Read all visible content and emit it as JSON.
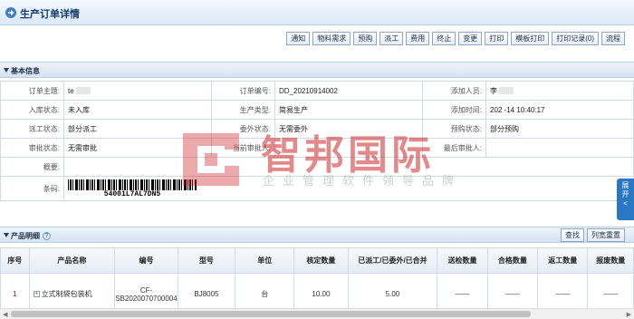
{
  "page": {
    "title": "生产订单详情"
  },
  "toolbar": [
    "通知",
    "物料需求",
    "预购",
    "派工",
    "费用",
    "终止",
    "变更",
    "打印",
    "模板打印",
    "打印记录(0)",
    "流程"
  ],
  "basic_info": {
    "heading": "基本信息",
    "subject_label": "订单主题:",
    "subject_value": "te",
    "order_no_label": "订单编号:",
    "order_no_value": "DD_20210914002",
    "added_by_label": "添加人员:",
    "added_by_value": "李",
    "inbound_label": "入库状态:",
    "inbound_value": "未入库",
    "prod_type_label": "生产类型:",
    "prod_type_value": "简易生产",
    "added_time_label": "添加时间:",
    "added_time_value": "202 -14 10:40:17",
    "dispatch_label": "派工状态:",
    "dispatch_value": "部分派工",
    "outsource_label": "委外状态:",
    "outsource_value": "无需委外",
    "prepurchase_label": "预购状态:",
    "prepurchase_value": "部分预购",
    "approval_label": "审批状态:",
    "approval_value": "无需审批",
    "current_approver_label": "当前审批人:",
    "current_approver_value": "",
    "last_approver_label": "最后审批人:",
    "last_approver_value": "",
    "summary_label": "概要:",
    "summary_value": "",
    "barcode_label": "条码:",
    "barcode_value": "54001L7AL7DN5"
  },
  "products": {
    "heading": "产品明细",
    "buttons": {
      "search": "查找",
      "reset_columns": "列宽重置"
    },
    "columns": [
      "序号",
      "产品名称",
      "编号",
      "型号",
      "单位",
      "核定数量",
      "已派工/已委外/已合并",
      "送检数量",
      "合格数量",
      "返工数量",
      "报废数量"
    ],
    "rows": [
      {
        "index": "1",
        "name": "立式制袋包装机",
        "code_line1": "CF-",
        "code_line2": "SB2020070700004",
        "model": "BJ8005",
        "unit": "台",
        "approved_qty": "10.00",
        "dispatched": "5.00",
        "inspect_qty": "——",
        "qualified_qty": "——",
        "rework_qty": "——",
        "scrap_qty": "——"
      }
    ]
  },
  "sidetab": {
    "line1": "展",
    "line2": "开",
    "line3": "<"
  },
  "watermark": {
    "logo_text": "智邦国际",
    "tagline": "企业管理软件领导品牌"
  }
}
